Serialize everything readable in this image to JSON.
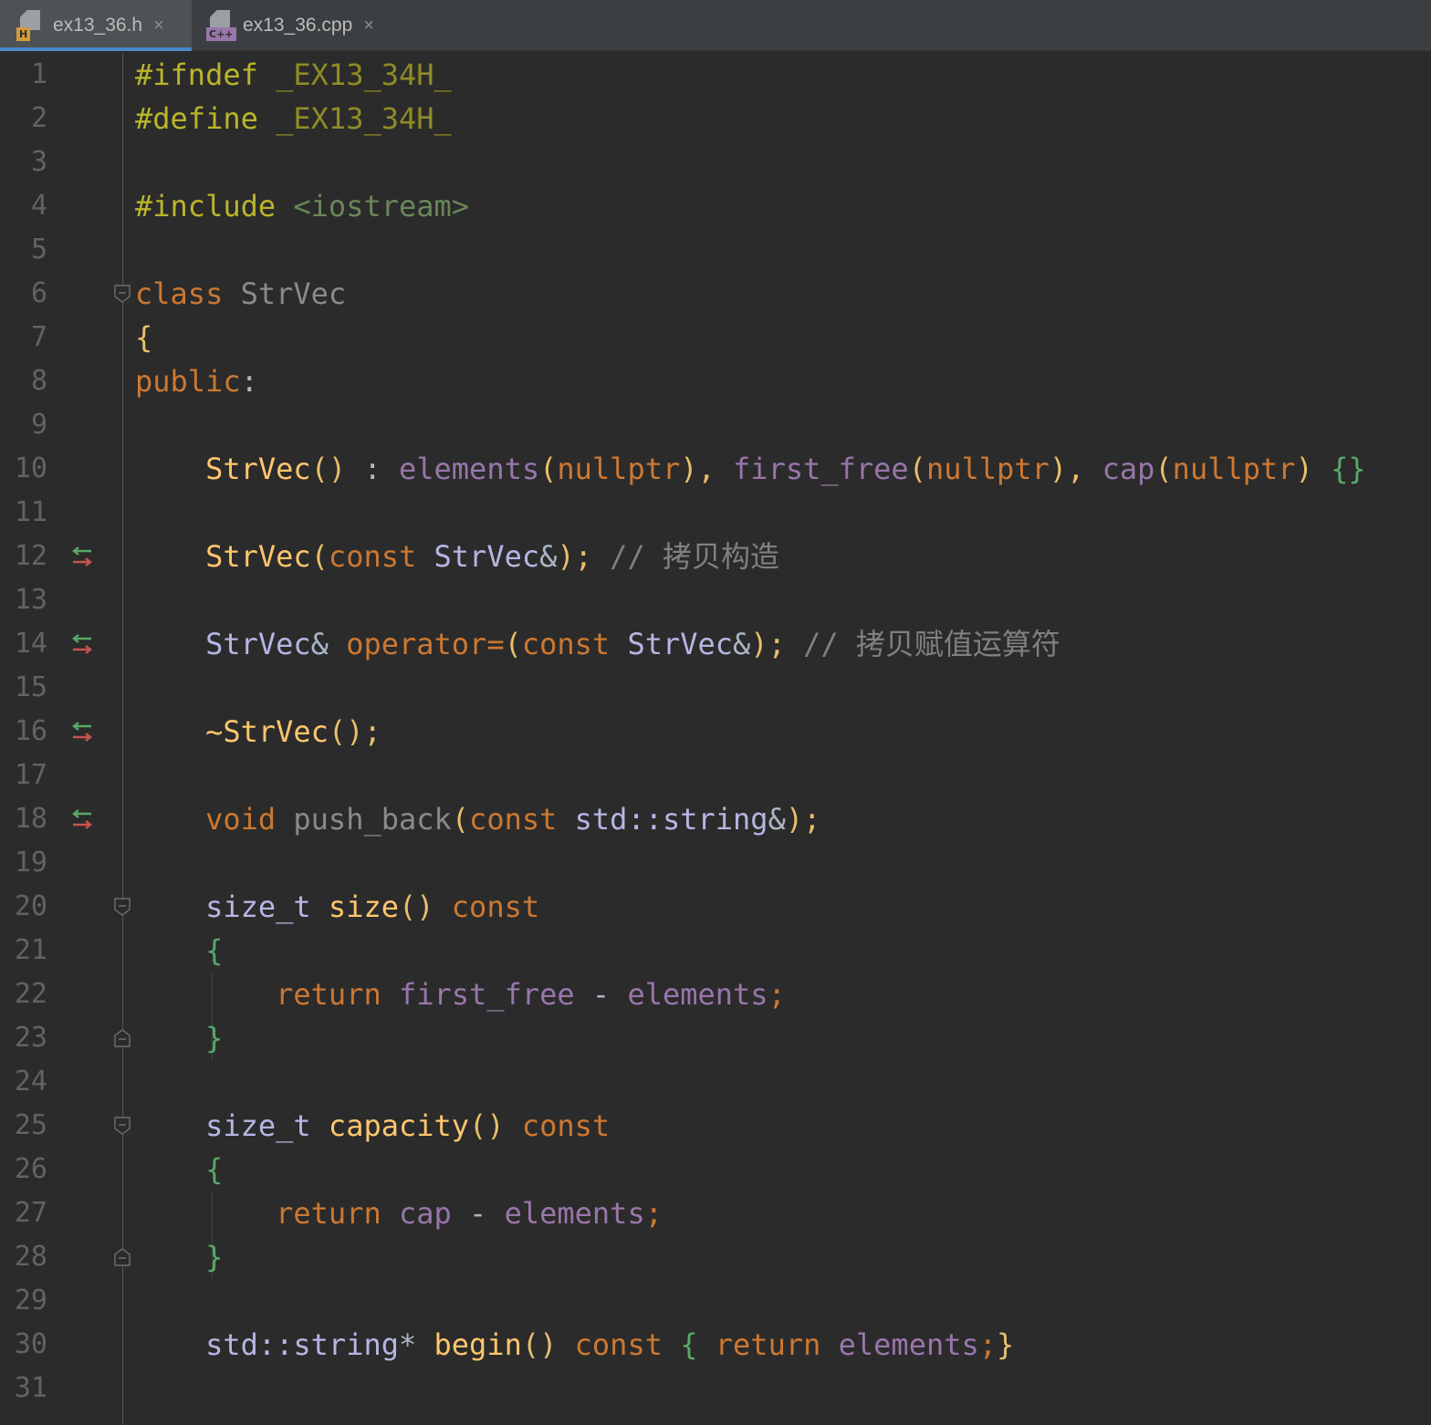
{
  "tabs": [
    {
      "label": "ex13_36.h",
      "badge": "H",
      "badge_color": "#d39b3a",
      "active": true
    },
    {
      "label": "ex13_36.cpp",
      "badge": "C++",
      "badge_color": "#9876aa",
      "active": false
    }
  ],
  "close_glyph": "×",
  "code_lines": [
    {
      "n": "1",
      "tokens": [
        {
          "t": "#ifndef ",
          "c": "pp"
        },
        {
          "t": "_EX13_34H_",
          "c": "mac"
        }
      ]
    },
    {
      "n": "2",
      "tokens": [
        {
          "t": "#define ",
          "c": "pp"
        },
        {
          "t": "_EX13_34H_",
          "c": "mac"
        }
      ]
    },
    {
      "n": "3",
      "tokens": []
    },
    {
      "n": "4",
      "tokens": [
        {
          "t": "#include ",
          "c": "pp"
        },
        {
          "t": "<iostream>",
          "c": "inc"
        }
      ]
    },
    {
      "n": "5",
      "tokens": []
    },
    {
      "n": "6",
      "tokens": [
        {
          "t": "class ",
          "c": "kw"
        },
        {
          "t": "StrVec",
          "c": "dim"
        }
      ],
      "fold": "open"
    },
    {
      "n": "7",
      "tokens": [
        {
          "t": "{",
          "c": "brace"
        }
      ]
    },
    {
      "n": "8",
      "tokens": [
        {
          "t": "public",
          "c": "kw"
        },
        {
          "t": ":",
          "c": "plain"
        }
      ]
    },
    {
      "n": "9",
      "tokens": []
    },
    {
      "n": "10",
      "tokens": [
        {
          "t": "    ",
          "c": "plain"
        },
        {
          "t": "StrVec",
          "c": "fn"
        },
        {
          "t": "()",
          "c": "brace"
        },
        {
          "t": " : ",
          "c": "plain"
        },
        {
          "t": "elements",
          "c": "fld"
        },
        {
          "t": "(",
          "c": "brace"
        },
        {
          "t": "nullptr",
          "c": "kw"
        },
        {
          "t": "), ",
          "c": "brace"
        },
        {
          "t": "first_free",
          "c": "fld"
        },
        {
          "t": "(",
          "c": "brace"
        },
        {
          "t": "nullptr",
          "c": "kw"
        },
        {
          "t": "), ",
          "c": "brace"
        },
        {
          "t": "cap",
          "c": "fld"
        },
        {
          "t": "(",
          "c": "brace"
        },
        {
          "t": "nullptr",
          "c": "kw"
        },
        {
          "t": ") ",
          "c": "brace"
        },
        {
          "t": "{}",
          "c": "gbrace"
        }
      ]
    },
    {
      "n": "11",
      "tokens": []
    },
    {
      "n": "12",
      "tokens": [
        {
          "t": "    ",
          "c": "plain"
        },
        {
          "t": "StrVec",
          "c": "fn"
        },
        {
          "t": "(",
          "c": "brace"
        },
        {
          "t": "const ",
          "c": "kw"
        },
        {
          "t": "StrVec",
          "c": "typ"
        },
        {
          "t": "&",
          "c": "plain"
        },
        {
          "t": ");",
          "c": "brace"
        },
        {
          "t": " // 拷贝构造",
          "c": "cmt"
        }
      ],
      "marker": true
    },
    {
      "n": "13",
      "tokens": []
    },
    {
      "n": "14",
      "tokens": [
        {
          "t": "    ",
          "c": "plain"
        },
        {
          "t": "StrVec",
          "c": "typ"
        },
        {
          "t": "& ",
          "c": "plain"
        },
        {
          "t": "operator=",
          "c": "kw"
        },
        {
          "t": "(",
          "c": "brace"
        },
        {
          "t": "const ",
          "c": "kw"
        },
        {
          "t": "StrVec",
          "c": "typ"
        },
        {
          "t": "&",
          "c": "plain"
        },
        {
          "t": ");",
          "c": "brace"
        },
        {
          "t": " // 拷贝赋值运算符",
          "c": "cmt"
        }
      ],
      "marker": true
    },
    {
      "n": "15",
      "tokens": []
    },
    {
      "n": "16",
      "tokens": [
        {
          "t": "    ",
          "c": "plain"
        },
        {
          "t": "~StrVec",
          "c": "fn"
        },
        {
          "t": "();",
          "c": "brace"
        }
      ],
      "marker": true
    },
    {
      "n": "17",
      "tokens": []
    },
    {
      "n": "18",
      "tokens": [
        {
          "t": "    ",
          "c": "plain"
        },
        {
          "t": "void ",
          "c": "kw"
        },
        {
          "t": "push_back",
          "c": "dim"
        },
        {
          "t": "(",
          "c": "brace"
        },
        {
          "t": "const ",
          "c": "kw"
        },
        {
          "t": "std::string",
          "c": "typ"
        },
        {
          "t": "&",
          "c": "plain"
        },
        {
          "t": ");",
          "c": "brace"
        }
      ],
      "marker": true
    },
    {
      "n": "19",
      "tokens": []
    },
    {
      "n": "20",
      "tokens": [
        {
          "t": "    ",
          "c": "plain"
        },
        {
          "t": "size_t ",
          "c": "typ"
        },
        {
          "t": "size",
          "c": "fn"
        },
        {
          "t": "()",
          "c": "brace"
        },
        {
          "t": " const",
          "c": "kw"
        }
      ],
      "fold": "open"
    },
    {
      "n": "21",
      "tokens": [
        {
          "t": "    ",
          "c": "plain"
        },
        {
          "t": "{",
          "c": "gbrace"
        }
      ]
    },
    {
      "n": "22",
      "tokens": [
        {
          "t": "        ",
          "c": "plain"
        },
        {
          "t": "return ",
          "c": "kw"
        },
        {
          "t": "first_free",
          "c": "fld"
        },
        {
          "t": " - ",
          "c": "plain"
        },
        {
          "t": "elements",
          "c": "fld"
        },
        {
          "t": ";",
          "c": "kw"
        }
      ]
    },
    {
      "n": "23",
      "tokens": [
        {
          "t": "    ",
          "c": "plain"
        },
        {
          "t": "}",
          "c": "gbrace"
        }
      ],
      "fold": "close"
    },
    {
      "n": "24",
      "tokens": []
    },
    {
      "n": "25",
      "tokens": [
        {
          "t": "    ",
          "c": "plain"
        },
        {
          "t": "size_t ",
          "c": "typ"
        },
        {
          "t": "capacity",
          "c": "fn"
        },
        {
          "t": "()",
          "c": "brace"
        },
        {
          "t": " const",
          "c": "kw"
        }
      ],
      "fold": "open"
    },
    {
      "n": "26",
      "tokens": [
        {
          "t": "    ",
          "c": "plain"
        },
        {
          "t": "{",
          "c": "gbrace"
        }
      ]
    },
    {
      "n": "27",
      "tokens": [
        {
          "t": "        ",
          "c": "plain"
        },
        {
          "t": "return ",
          "c": "kw"
        },
        {
          "t": "cap",
          "c": "fld"
        },
        {
          "t": " - ",
          "c": "plain"
        },
        {
          "t": "elements",
          "c": "fld"
        },
        {
          "t": ";",
          "c": "kw"
        }
      ]
    },
    {
      "n": "28",
      "tokens": [
        {
          "t": "    ",
          "c": "plain"
        },
        {
          "t": "}",
          "c": "gbrace"
        }
      ],
      "fold": "close"
    },
    {
      "n": "29",
      "tokens": []
    },
    {
      "n": "30",
      "tokens": [
        {
          "t": "    ",
          "c": "plain"
        },
        {
          "t": "std::string",
          "c": "typ"
        },
        {
          "t": "* ",
          "c": "plain"
        },
        {
          "t": "begin",
          "c": "fn"
        },
        {
          "t": "()",
          "c": "brace"
        },
        {
          "t": " const ",
          "c": "kw"
        },
        {
          "t": "{ ",
          "c": "gbrace"
        },
        {
          "t": "return ",
          "c": "kw"
        },
        {
          "t": "elements",
          "c": "fld"
        },
        {
          "t": ";",
          "c": "kw"
        },
        {
          "t": "}",
          "c": "brace"
        }
      ]
    },
    {
      "n": "31",
      "tokens": []
    }
  ],
  "colors": {
    "background": "#2b2b2b",
    "tabbar": "#3c3f41",
    "active_tab_underline": "#4a88c7",
    "marker_up": "#59a869",
    "marker_down": "#c75450"
  },
  "icons": {
    "tab_file": "file-icon",
    "close": "close-icon",
    "marker": "override-arrows-icon",
    "fold_open": "fold-open-icon",
    "fold_close": "fold-close-icon"
  }
}
